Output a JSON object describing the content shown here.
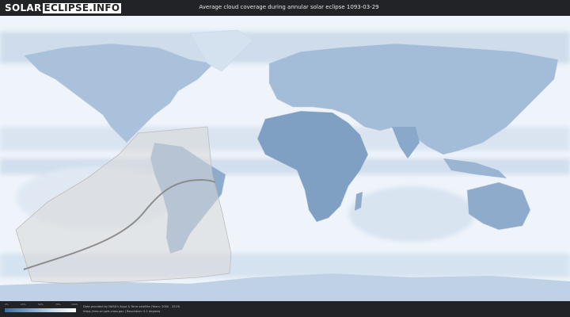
{
  "header": {
    "logo_left": "SOLAR",
    "logo_right": "ECLIPSE.INFO",
    "title": "Average cloud coverage during annular solar eclipse 1093-03-29"
  },
  "legend": {
    "ticks": [
      "0%",
      "25%",
      "50%",
      "75%",
      "100%"
    ],
    "gradient_colors": [
      "#3f6f9f",
      "#7f9fc3",
      "#c4d6e8",
      "#ffffff"
    ]
  },
  "footer": {
    "credit_line1": "Data provided by NASA's Aqua & Terra satellite (Years: 2000 - 2019)",
    "credit_line2": "https://neo.sci.gsfc.nasa.gov | Resolution: 0.1 degrees"
  },
  "colors": {
    "ocean_clear": "#eef4fa",
    "land_low_cloud": "#7f9fc3",
    "land_mid_cloud": "#a7bfd9",
    "eclipse_region": "#d9d9d9",
    "central_line": "#8c8c8c"
  }
}
